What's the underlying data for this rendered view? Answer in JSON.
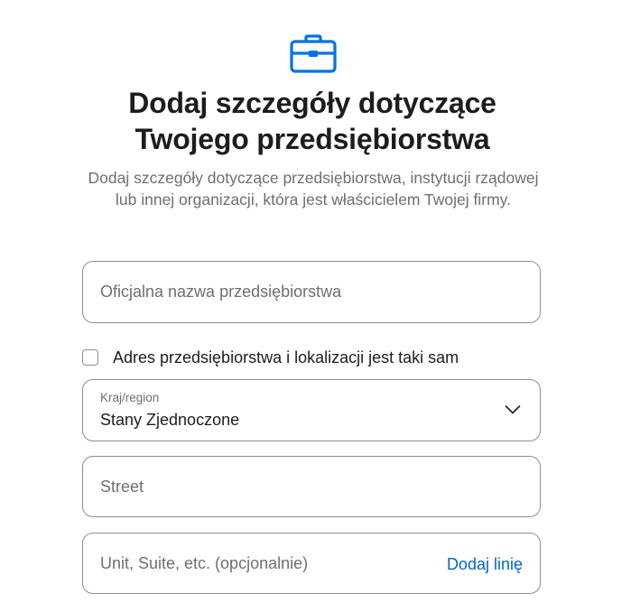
{
  "header": {
    "icon": "briefcase-icon",
    "title_line1": "Dodaj szczegóły dotyczące",
    "title_line2": "Twojego przedsiębiorstwa",
    "subtitle": "Dodaj szczegóły dotyczące przedsiębiorstwa, instytucji rządowej lub innej organizacji, która jest właścicielem Twojej firmy."
  },
  "form": {
    "company_name": {
      "placeholder": "Oficjalna nazwa przedsiębiorstwa",
      "value": ""
    },
    "same_address_checkbox": {
      "label": "Adres przedsiębiorstwa i lokalizacji jest taki sam",
      "checked": false
    },
    "country": {
      "label": "Kraj/region",
      "value": "Stany Zjednoczone"
    },
    "street": {
      "placeholder": "Street",
      "value": ""
    },
    "unit": {
      "placeholder": "Unit, Suite, etc. (opcjonalnie)",
      "value": "",
      "add_line_label": "Dodaj linię"
    }
  },
  "colors": {
    "accent": "#0071e3",
    "link": "#0066cc",
    "text": "#1d1d1f",
    "secondary_text": "#6e6e73",
    "border": "#8e8e93"
  }
}
